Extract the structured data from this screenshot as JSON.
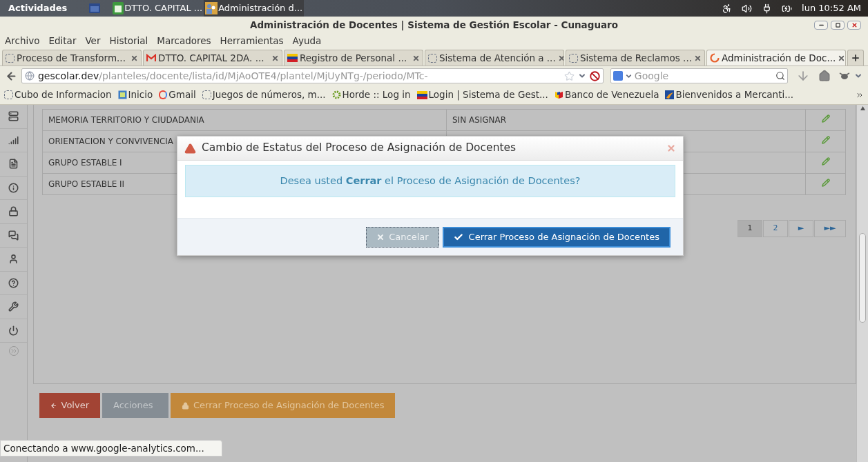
{
  "system_bar": {
    "activities": "Actividades",
    "apps": [
      {
        "label": "DTTO. CAPITAL ...",
        "kind": "sheet"
      },
      {
        "label": "Administración d...",
        "kind": "people"
      }
    ],
    "clock": "lun 10:52 AM"
  },
  "window": {
    "title": "Administración de Docentes | Sistema de Gestión Escolar - Cunaguaro"
  },
  "menu": [
    "Archivo",
    "Editar",
    "Ver",
    "Historial",
    "Marcadores",
    "Herramientas",
    "Ayuda"
  ],
  "tabs": [
    {
      "label": "Proceso de Transform...",
      "kind": "blank",
      "selected": false
    },
    {
      "label": "DTTO. CAPITAL 2DA. ...",
      "kind": "gmail",
      "selected": false
    },
    {
      "label": "Registro de Personal ...",
      "kind": "flag",
      "selected": false
    },
    {
      "label": "Sistema de Atención a ...",
      "kind": "blank",
      "selected": false
    },
    {
      "label": "Sistema de Reclamos ...",
      "kind": "blank",
      "selected": false
    },
    {
      "label": "Administración de Doc...",
      "kind": "loading",
      "selected": true
    }
  ],
  "address": {
    "host": "gescolar.dev",
    "path": "/planteles/docente/lista/id/MjAoOTE4/plantel/MjUyNTg-/periodo/MTc-"
  },
  "search": {
    "placeholder": "Google"
  },
  "bookmarks": [
    {
      "label": "Cubo de Informacion",
      "kind": "blank"
    },
    {
      "label": "Inicio",
      "kind": "page"
    },
    {
      "label": "Gmail",
      "kind": "google"
    },
    {
      "label": "Juegos de números, m...",
      "kind": "blank"
    },
    {
      "label": "Horde :: Log in",
      "kind": "gear"
    },
    {
      "label": "Login | Sistema de Gest...",
      "kind": "flag"
    },
    {
      "label": "Banco de Venezuela",
      "kind": "bank"
    },
    {
      "label": "Bienvenidos a Mercanti...",
      "kind": "mercantil"
    }
  ],
  "table": {
    "rows": [
      {
        "subject": "MEMORIA TERRITORIO Y CIUDADANIA",
        "teacher": "SIN ASIGNAR"
      },
      {
        "subject": "ORIENTACION Y CONVIVENCIA"
      },
      {
        "subject": "GRUPO ESTABLE I"
      },
      {
        "subject": "GRUPO ESTABLE II"
      }
    ]
  },
  "pagination": [
    {
      "label": "1",
      "selected": true
    },
    {
      "label": "2",
      "selected": false
    },
    {
      "label": "►",
      "selected": false
    },
    {
      "label": "►►",
      "selected": false
    }
  ],
  "actions": [
    {
      "label": "Volver",
      "kind": "back"
    },
    {
      "label": "Acciones",
      "kind": "dropdown"
    },
    {
      "label": "Cerrar Proceso de Asignación de Docentes",
      "kind": "lock"
    }
  ],
  "modal": {
    "title": "Cambio de Estatus del Proceso de Asignación de Docentes",
    "message": "Desea usted **Cerrar** el Proceso de Asignación de Docentes?",
    "buttons": [
      {
        "label": "Cancelar",
        "kind": "cancel"
      },
      {
        "label": "Cerrar Proceso de Asignación de Docentes",
        "kind": "confirm"
      }
    ]
  },
  "status_bar": "Conectando a www.google-analytics.com..."
}
